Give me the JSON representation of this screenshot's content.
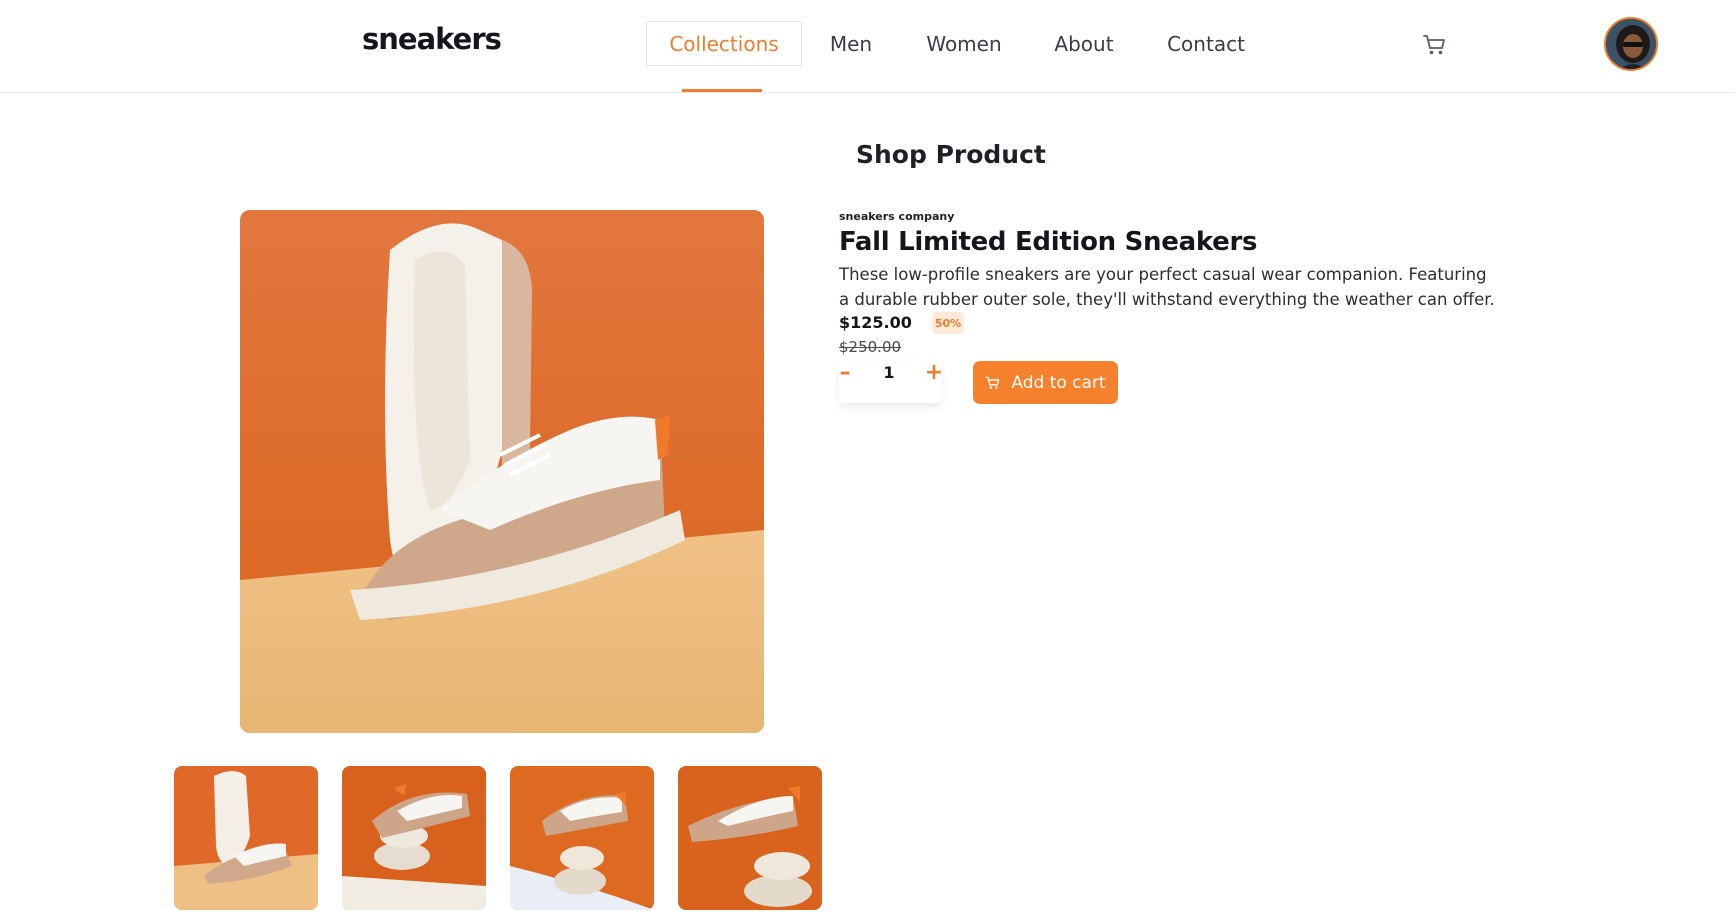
{
  "header": {
    "logo": "sneakers",
    "nav": [
      {
        "label": "Collections",
        "active": true
      },
      {
        "label": "Men",
        "active": false
      },
      {
        "label": "Women",
        "active": false
      },
      {
        "label": "About",
        "active": false
      },
      {
        "label": "Contact",
        "active": false
      }
    ],
    "cart_icon": "cart-icon",
    "avatar_icon": "user-avatar"
  },
  "gallery": {
    "main_image": "product-photo-1",
    "thumbnails": [
      "product-photo-1",
      "product-photo-2",
      "product-photo-3",
      "product-photo-4"
    ]
  },
  "product": {
    "section_title": "Shop Product",
    "company": "sneakers company",
    "title": "Fall Limited Edition Sneakers",
    "description": "These low-profile sneakers are your perfect casual wear companion. Featuring a durable rubber outer sole, they'll withstand everything the weather can offer.",
    "price": "$125.00",
    "discount": "50%",
    "old_price": "$250.00",
    "quantity": "1",
    "qty_minus": "–",
    "qty_plus": "+",
    "add_to_cart": "Add to cart"
  },
  "colors": {
    "accent": "#f6812c",
    "accent_light": "#ffe9d9",
    "text_dark": "#15161b"
  }
}
